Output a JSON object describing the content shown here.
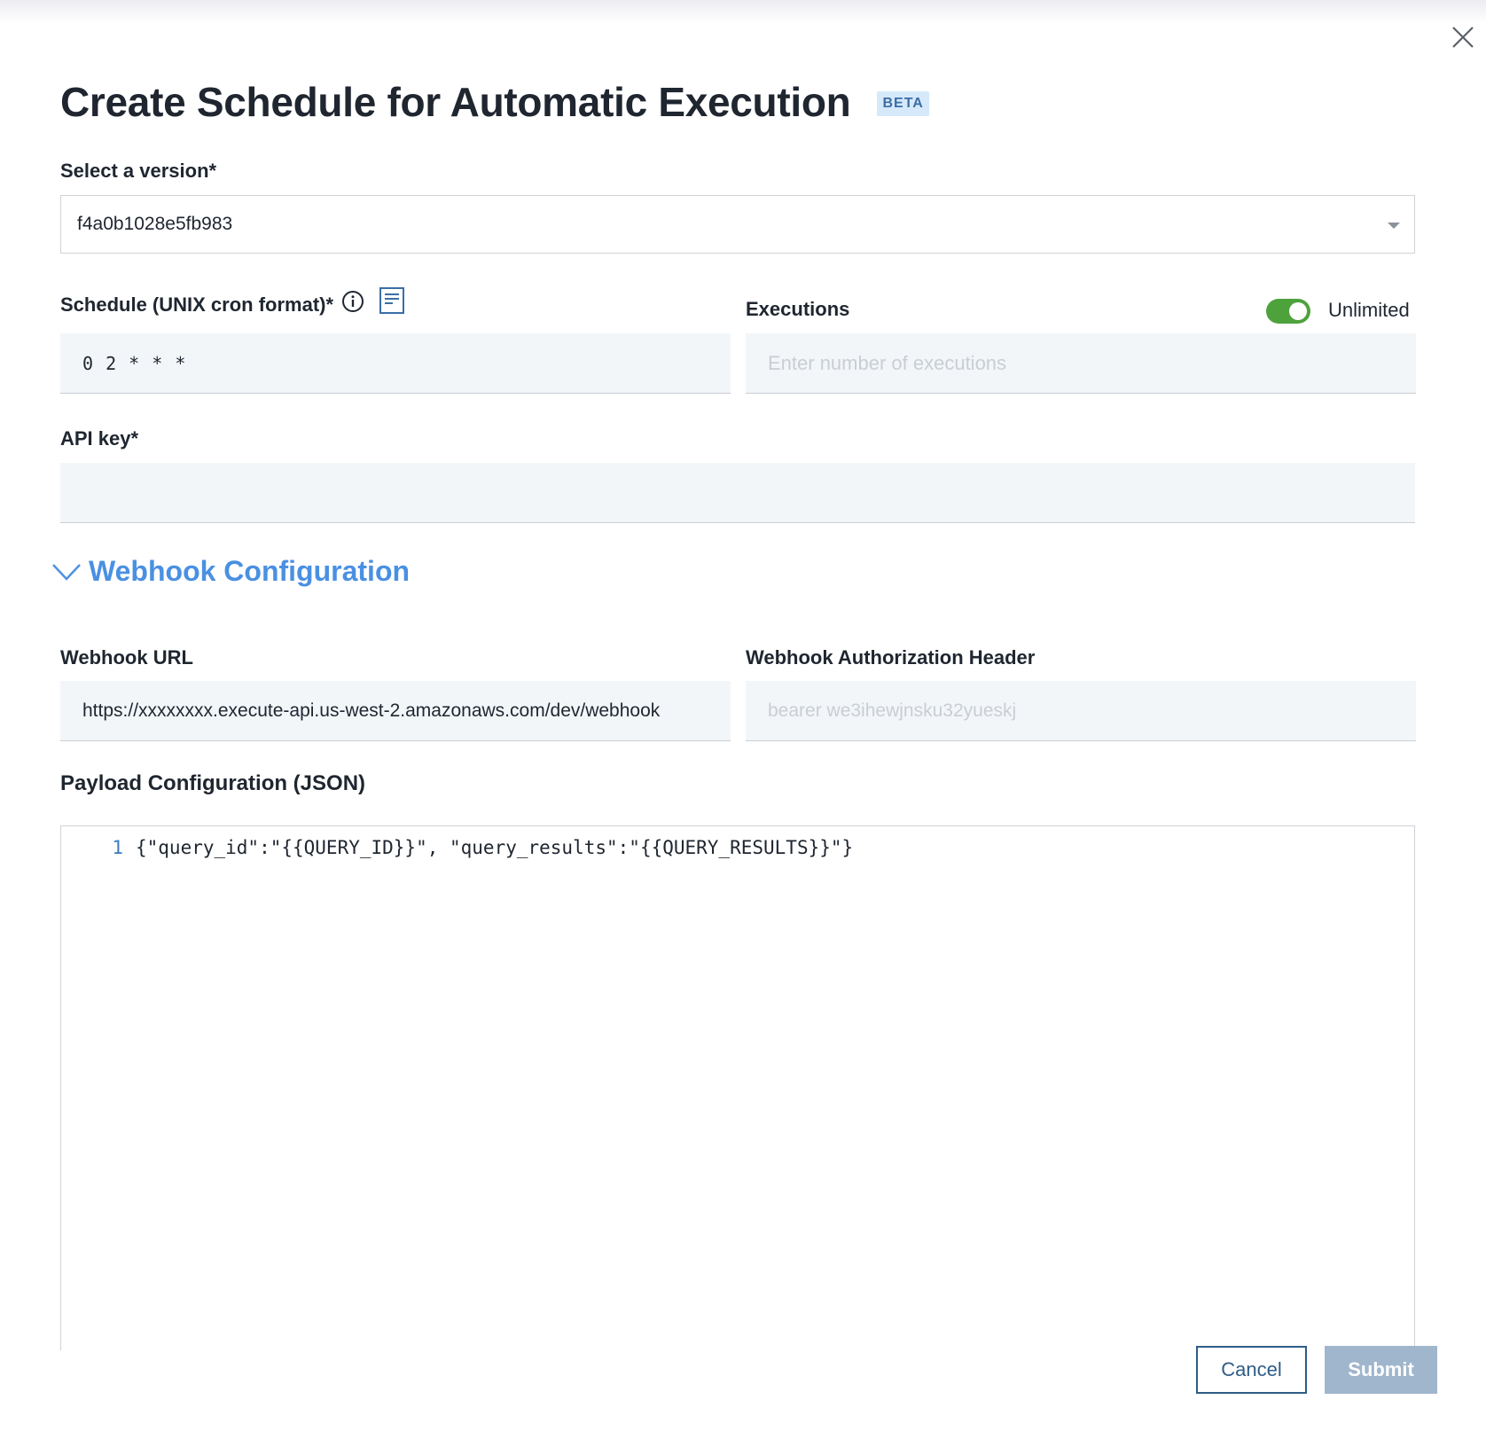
{
  "dialog": {
    "title": "Create Schedule for Automatic Execution",
    "badge": "BETA"
  },
  "version": {
    "label": "Select a version*",
    "value": "f4a0b1028e5fb983"
  },
  "schedule": {
    "label": "Schedule (UNIX cron format)*",
    "value": "0 2 * * *"
  },
  "executions": {
    "label": "Executions",
    "placeholder": "Enter number of executions",
    "toggle_label": "Unlimited",
    "toggle_on": true
  },
  "api_key": {
    "label": "API key*",
    "value": ""
  },
  "webhook_section": {
    "title": "Webhook Configuration",
    "expanded": true
  },
  "webhook_url": {
    "label": "Webhook URL",
    "value": "https://xxxxxxxx.execute-api.us-west-2.amazonaws.com/dev/webhook"
  },
  "webhook_auth": {
    "label": "Webhook Authorization Header",
    "placeholder": "bearer we3ihewjnsku32yueskj"
  },
  "payload": {
    "label": "Payload Configuration (JSON)",
    "line_number": "1",
    "code": "{\"query_id\":\"{{QUERY_ID}}\", \"query_results\":\"{{QUERY_RESULTS}}\"}"
  },
  "actions": {
    "cancel": "Cancel",
    "submit": "Submit"
  },
  "colors": {
    "accent": "#4a90e2",
    "toggle_on": "#4ea23c",
    "submit_disabled": "#9fb6cc",
    "cancel_border": "#2f5c86"
  }
}
